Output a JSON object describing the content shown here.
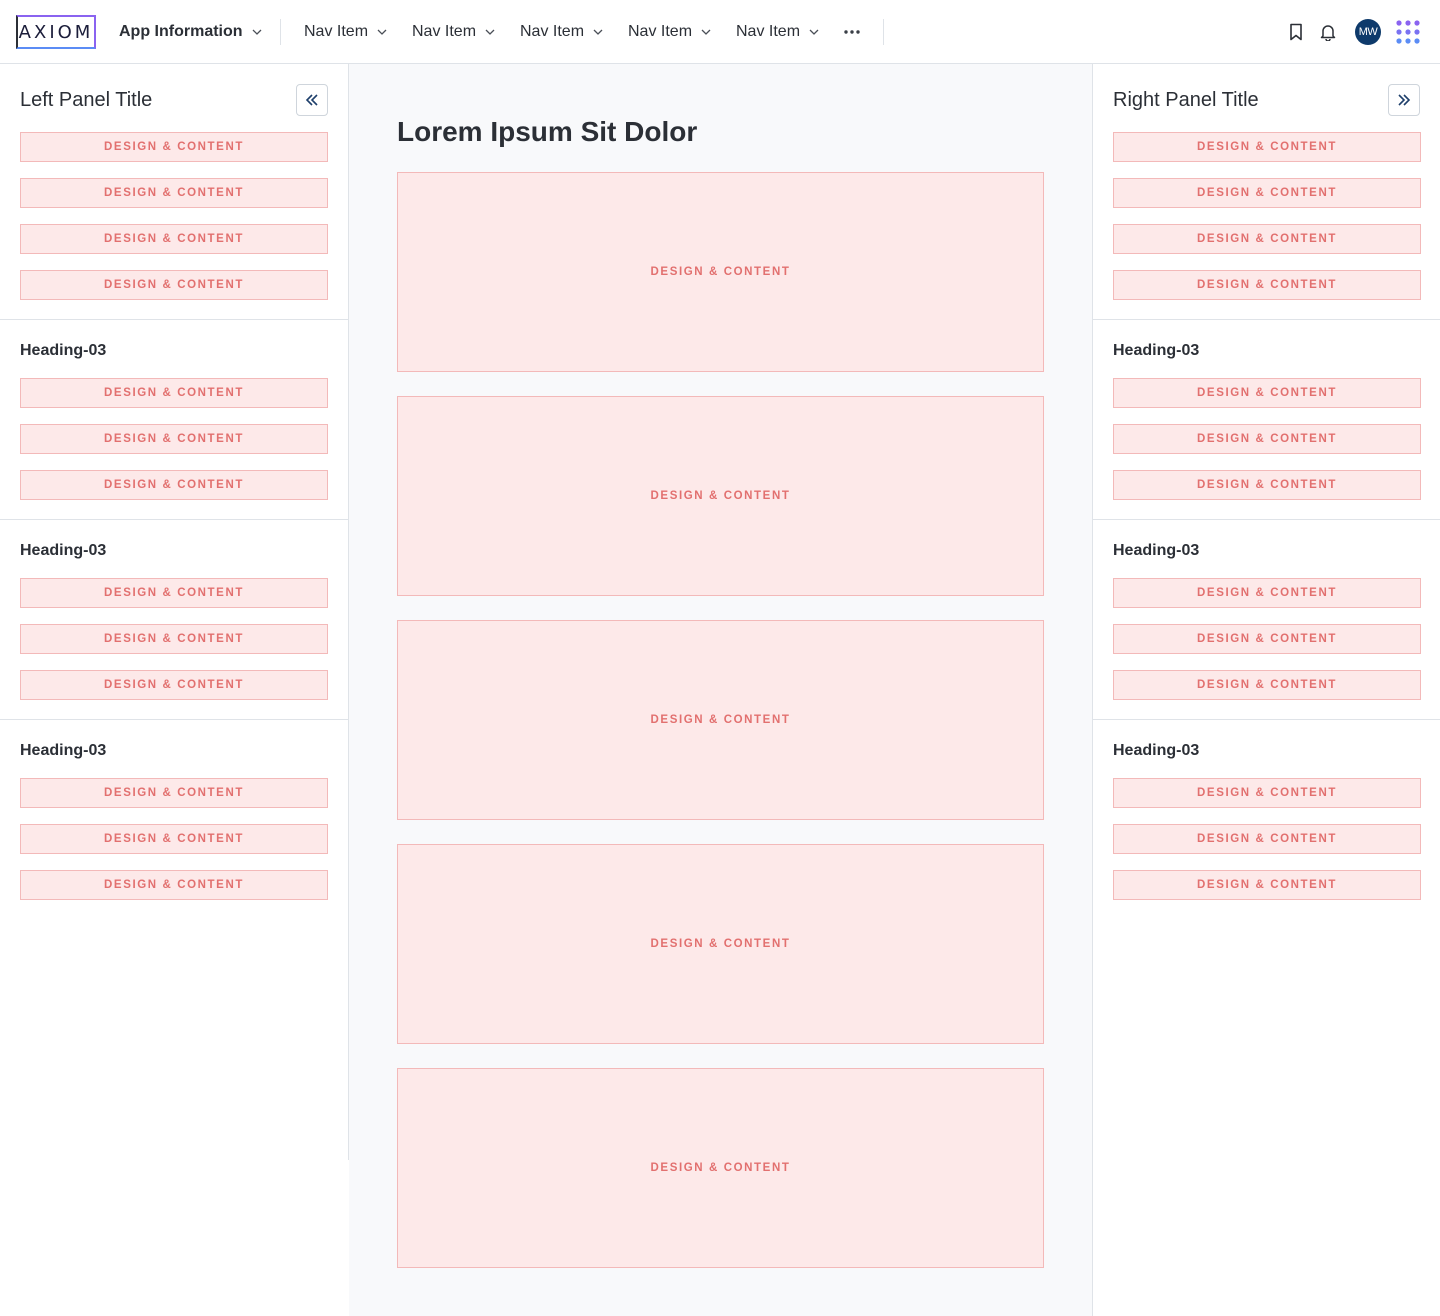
{
  "header": {
    "logo_text": "AXIOM",
    "app_info_label": "App Information",
    "nav_items": [
      "Nav Item",
      "Nav Item",
      "Nav Item",
      "Nav Item",
      "Nav Item"
    ],
    "avatar_initials": "MW"
  },
  "left_panel": {
    "title": "Left Panel Title",
    "top_items": [
      "DESIGN & CONTENT",
      "DESIGN & CONTENT",
      "DESIGN & CONTENT",
      "DESIGN & CONTENT"
    ],
    "sections": [
      {
        "heading": "Heading-03",
        "items": [
          "DESIGN & CONTENT",
          "DESIGN & CONTENT",
          "DESIGN & CONTENT"
        ]
      },
      {
        "heading": "Heading-03",
        "items": [
          "DESIGN & CONTENT",
          "DESIGN & CONTENT",
          "DESIGN & CONTENT"
        ]
      },
      {
        "heading": "Heading-03",
        "items": [
          "DESIGN & CONTENT",
          "DESIGN & CONTENT",
          "DESIGN & CONTENT"
        ]
      }
    ]
  },
  "main": {
    "title": "Lorem Ipsum Sit Dolor",
    "cards": [
      "DESIGN & CONTENT",
      "DESIGN & CONTENT",
      "DESIGN & CONTENT",
      "DESIGN & CONTENT",
      "DESIGN & CONTENT"
    ]
  },
  "right_panel": {
    "title": "Right Panel Title",
    "top_items": [
      "DESIGN & CONTENT",
      "DESIGN & CONTENT",
      "DESIGN & CONTENT",
      "DESIGN & CONTENT"
    ],
    "sections": [
      {
        "heading": "Heading-03",
        "items": [
          "DESIGN & CONTENT",
          "DESIGN & CONTENT",
          "DESIGN & CONTENT"
        ]
      },
      {
        "heading": "Heading-03",
        "items": [
          "DESIGN & CONTENT",
          "DESIGN & CONTENT",
          "DESIGN & CONTENT"
        ]
      },
      {
        "heading": "Heading-03",
        "items": [
          "DESIGN & CONTENT",
          "DESIGN & CONTENT",
          "DESIGN & CONTENT"
        ]
      }
    ]
  },
  "icons": {
    "app_chevron": "chevron-down-icon",
    "more": "more-horizontal-icon",
    "bookmark": "bookmark-icon",
    "notifications": "bell-icon",
    "app_switcher": "app-grid-icon",
    "left_collapse": "chevrons-left-icon",
    "right_collapse": "chevrons-right-icon"
  },
  "colors": {
    "placeholder_fill": "#fde9e9",
    "placeholder_border": "#f3b9b9",
    "placeholder_text": "#e2706f",
    "avatar_bg": "#0e3a6b",
    "logo_accent": "#8a63f0"
  }
}
